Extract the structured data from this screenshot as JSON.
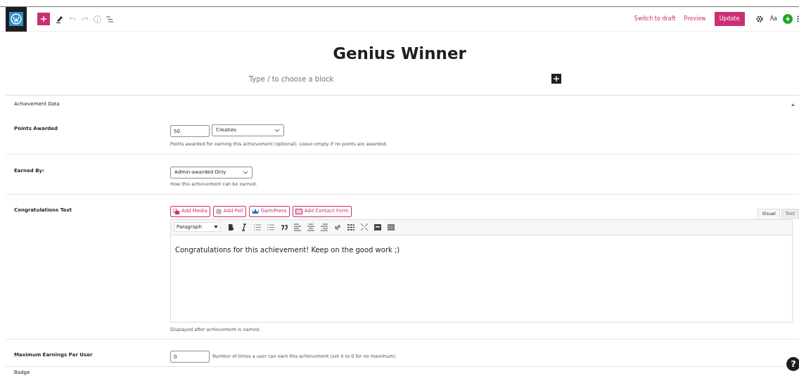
{
  "toolbar": {
    "right_links": [
      "Switch to draft",
      "Preview"
    ],
    "update_button": "Update",
    "font_button": "Aa"
  },
  "post_title": "Genius Winner",
  "block_placeholder": "Type / to choose a block",
  "metabox": {
    "title": "Achievement Data",
    "expanded": true,
    "points_awarded": {
      "label": "Points Awarded",
      "value": "50",
      "type_select": "Creaties",
      "help": "Points awarded for earning this achievement (optional). Leave empty if no points are awarded."
    },
    "earned_by": {
      "label": "Earned By:",
      "select": "Admin-awarded Only",
      "help": "How this achievement can be earned."
    },
    "congratulations": {
      "label": "Congratulations Text",
      "media_buttons": [
        {
          "label": "Add Media",
          "kind": "media"
        },
        {
          "label": "Add Poll",
          "kind": "poll"
        },
        {
          "label": "GamiPress",
          "kind": "crown"
        },
        {
          "label": "Add Contact Form",
          "kind": "form"
        }
      ],
      "tabs": [
        {
          "label": "Visual",
          "selected": true
        },
        {
          "label": "Text",
          "selected": false
        }
      ],
      "format_select": "Paragraph",
      "content": "Congratulations for this achievement! Keep on the good work ;)",
      "help": "Displayed after achievement is earned."
    },
    "max_earnings": {
      "label": "Maximum Earnings Per User",
      "value": "0",
      "help": "Number of times a user can earn this achievement (set it to 0 for no maximum)."
    },
    "next_label": "Badge"
  },
  "help_button": "?"
}
